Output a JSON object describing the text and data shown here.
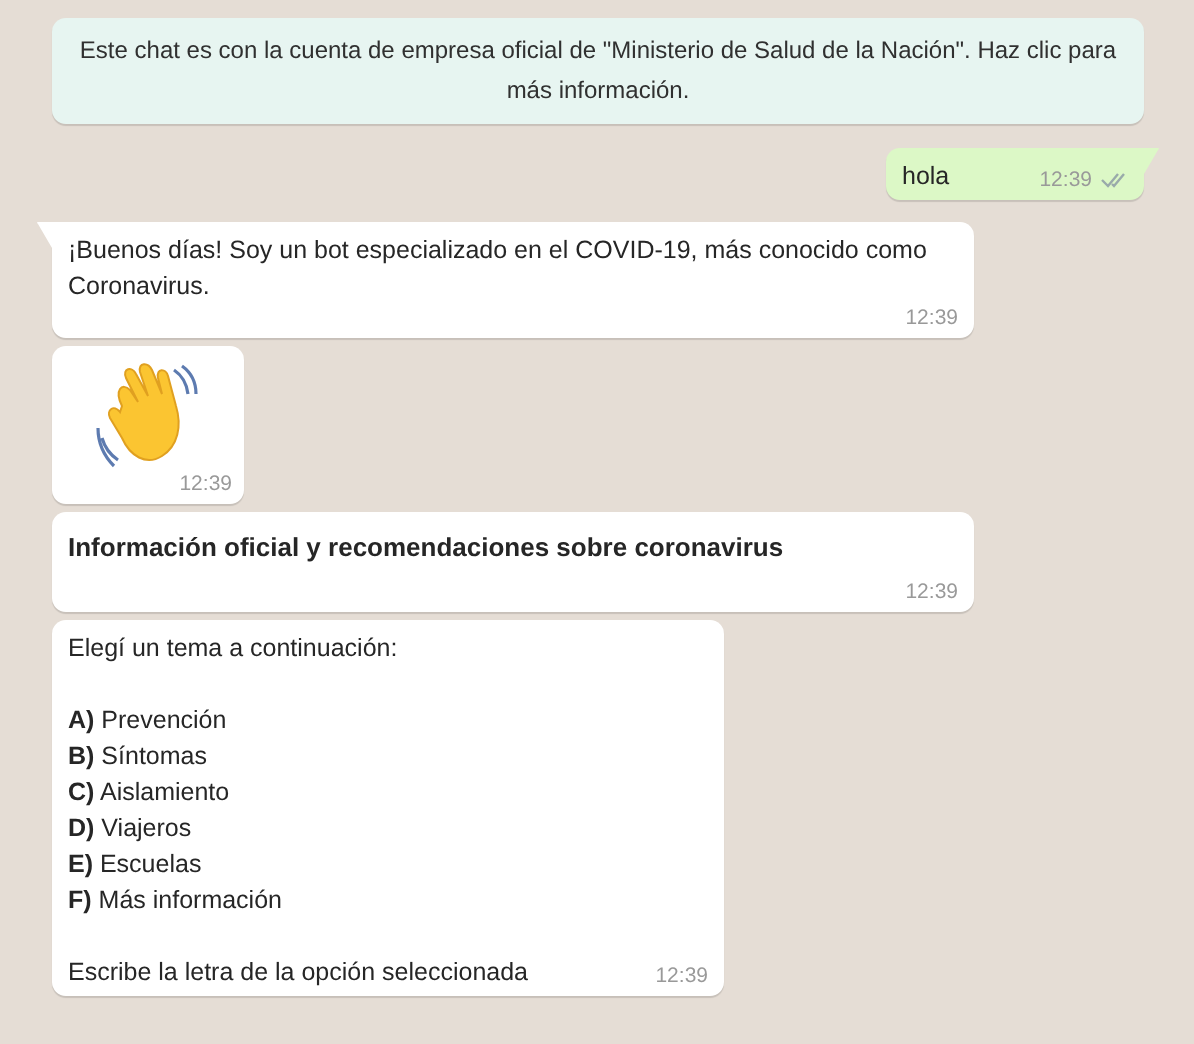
{
  "messages": [
    {
      "kind": "notice",
      "text": "Este chat es con la cuenta de empresa oficial de \"Ministerio de Salud de la Nación\". Haz clic para más información."
    },
    {
      "kind": "outgoing",
      "text": "hola",
      "time": "12:39",
      "delivered": true,
      "tail": true
    },
    {
      "kind": "incoming",
      "text": "¡Buenos días! Soy un bot especializado en el COVID-19, más conocido como Coronavirus.",
      "time": "12:39",
      "tail": true
    },
    {
      "kind": "emoji",
      "time": "12:39",
      "tail": false
    },
    {
      "kind": "heading",
      "text": "Información oficial y recomendaciones sobre coronavirus",
      "time": "12:39",
      "tail": false
    },
    {
      "kind": "menu",
      "intro": "Elegí un tema a continuación:",
      "options": [
        "**A)** Prevención",
        "**B)** Síntomas",
        "**C)** Aislamiento",
        "**D)** Viajeros",
        "**E)** Escuelas",
        "**F)** Más información"
      ],
      "footer": "Escribe la letra de la opción seleccionada",
      "time": "12:39",
      "tail": false
    }
  ]
}
